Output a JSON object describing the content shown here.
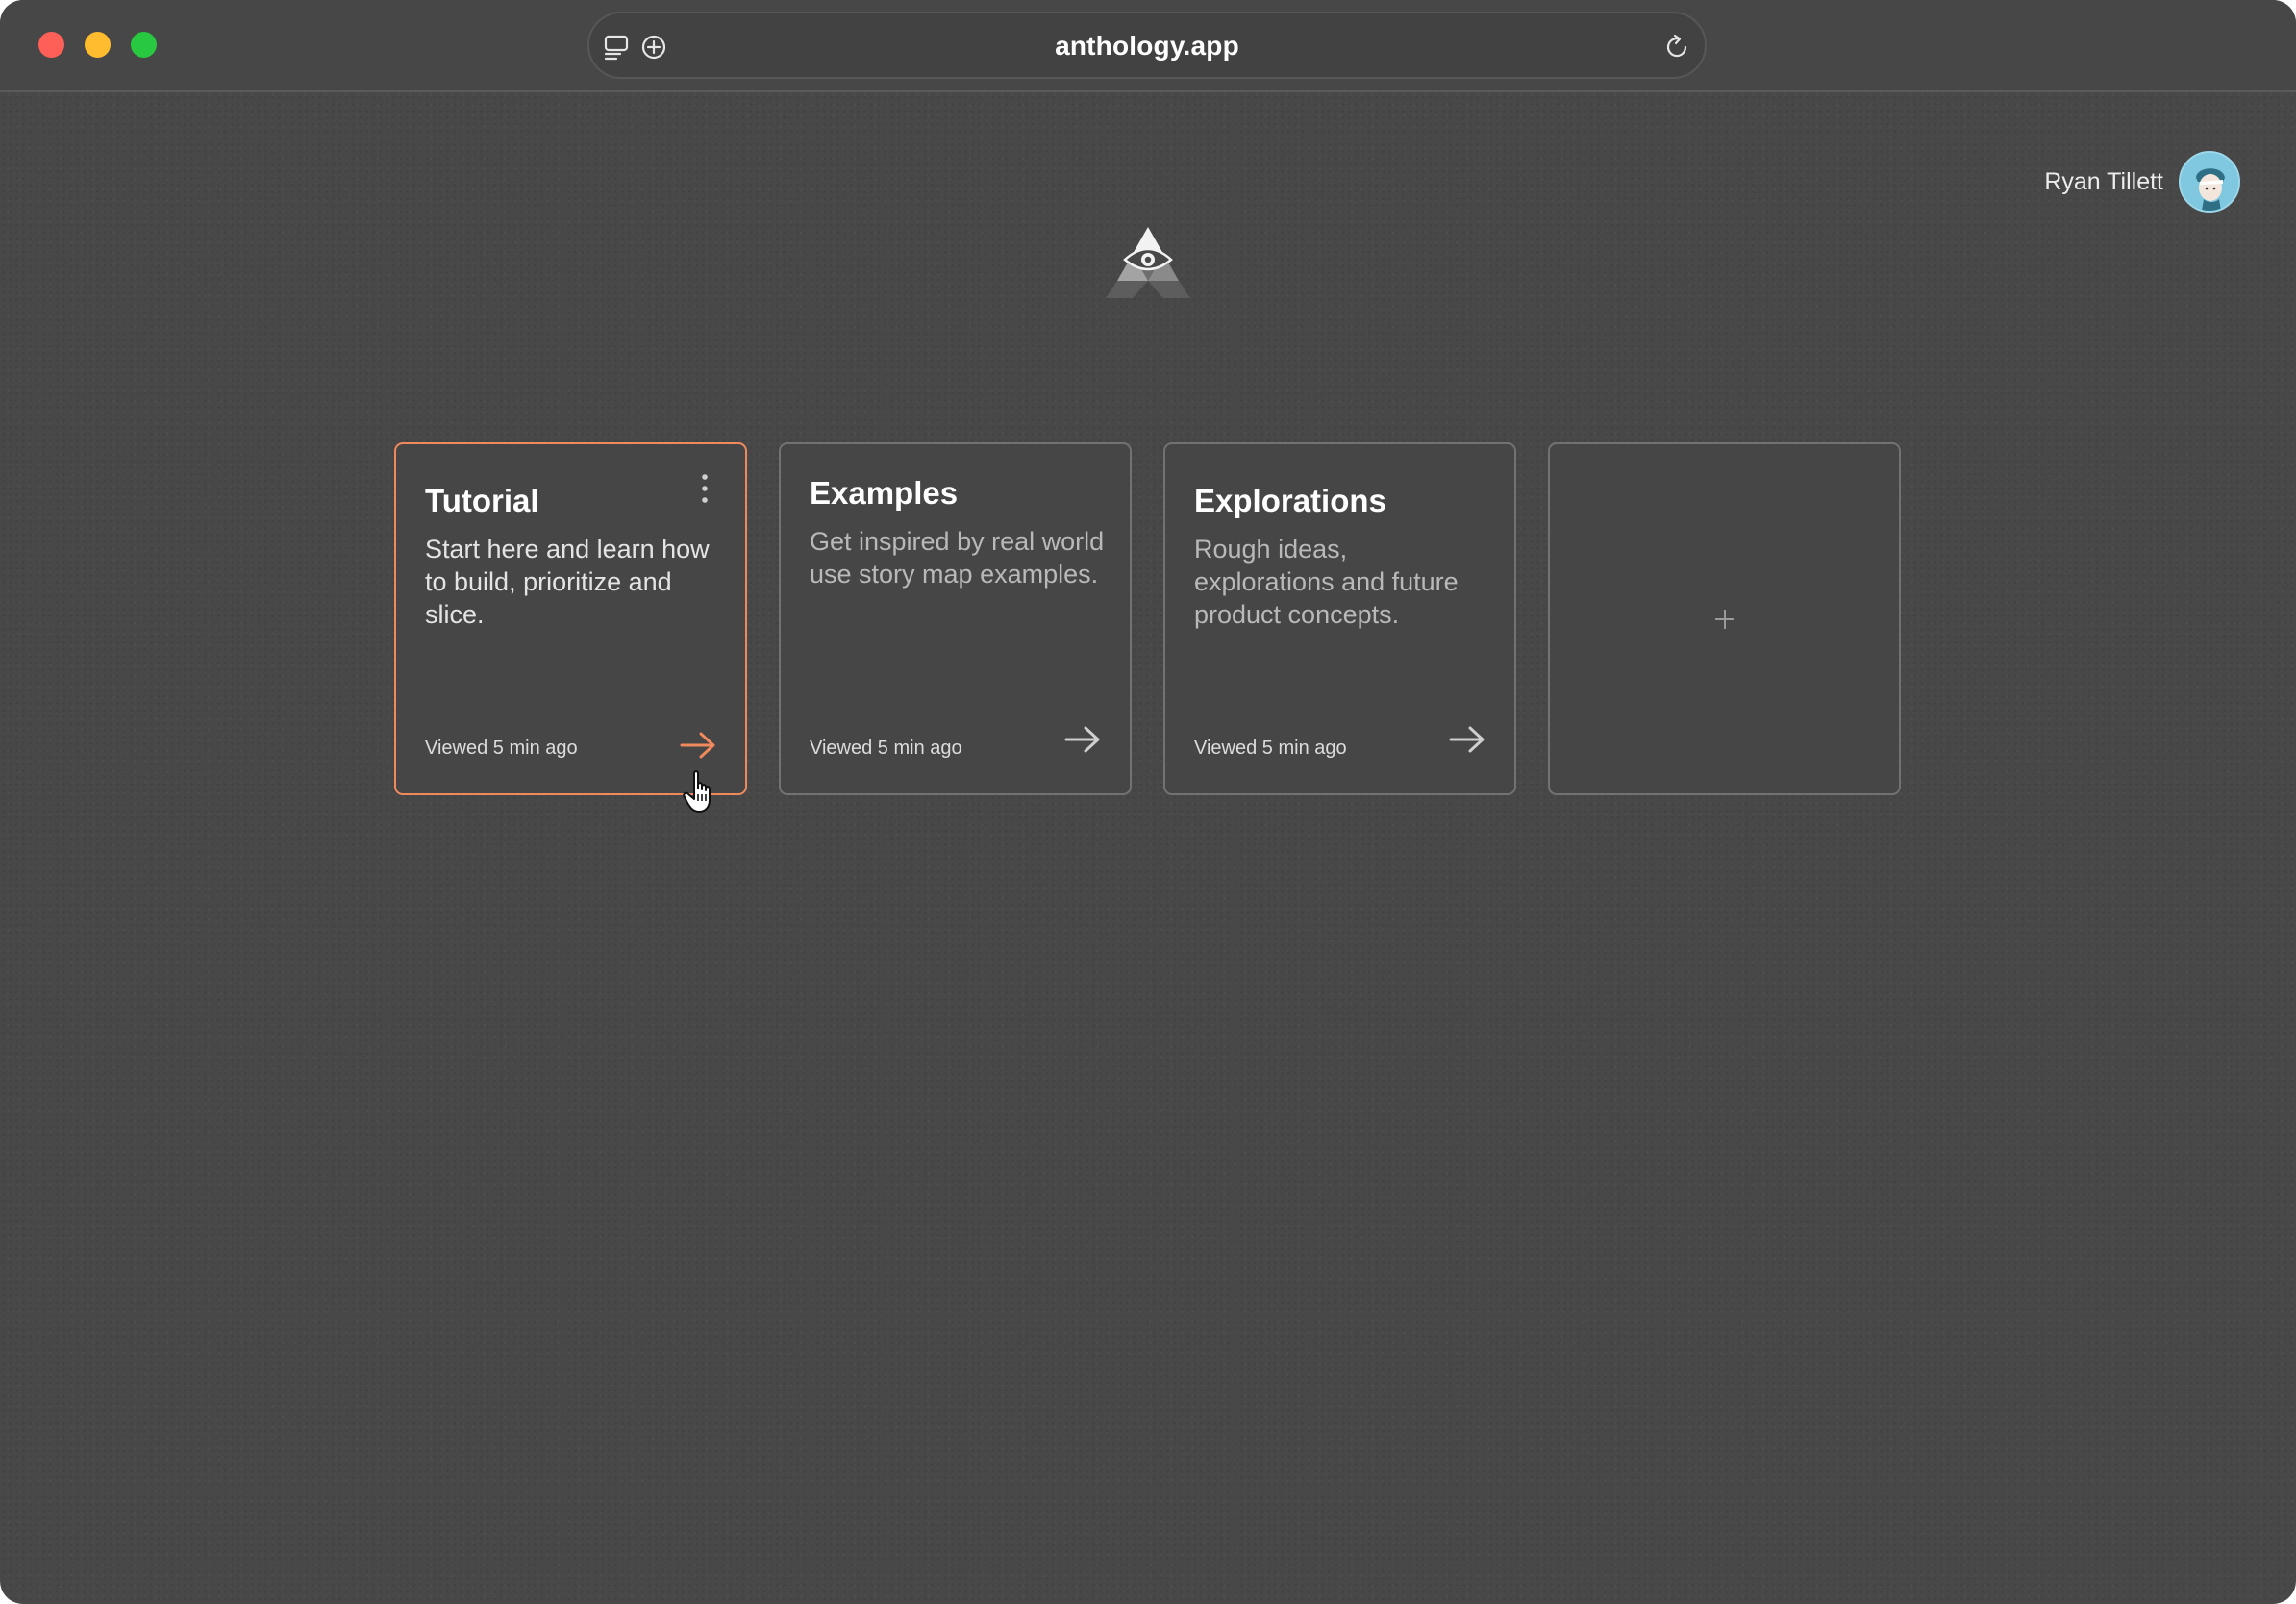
{
  "browser": {
    "url": "anthology.app"
  },
  "user": {
    "name": "Ryan Tillett"
  },
  "cards": [
    {
      "title": "Tutorial",
      "description": "Start here and learn how to build, prioritize and slice.",
      "meta": "Viewed 5 min ago",
      "state": "hovered"
    },
    {
      "title": "Examples",
      "description": "Get inspired by real world use story map examples.",
      "meta": "Viewed 5 min ago"
    },
    {
      "title": "Explorations",
      "description": "Rough ideas, explorations and future product concepts.",
      "meta": "Viewed 5 min ago"
    }
  ],
  "colors": {
    "accent": "#f08a5d",
    "background": "#484848",
    "card_border": "#727272"
  },
  "icons": {
    "sidebar": "sidebar-icon",
    "new_tab": "plus-circle-icon",
    "reload": "reload-icon",
    "logo": "eye-triangle-logo",
    "arrow": "arrow-right-icon",
    "menu": "more-vertical-icon",
    "add": "plus-icon"
  }
}
